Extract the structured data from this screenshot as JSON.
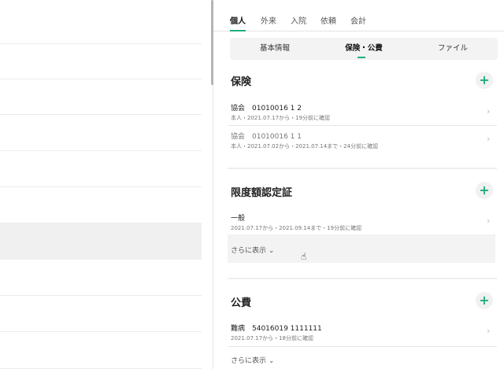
{
  "tabs": [
    "個人",
    "外来",
    "入院",
    "依頼",
    "会計"
  ],
  "subtabs": [
    "基本情報",
    "保険・公費",
    "ファイル"
  ],
  "sections": {
    "insurance": {
      "title": "保険",
      "items": [
        {
          "title": "協会　01010016 1 2",
          "sub": "本人・2021.07.17から・19分前に確認"
        },
        {
          "title": "協会　01010016 1 1",
          "sub": "本人・2021.07.02から・2021.07.14まで・24分前に確認"
        }
      ]
    },
    "limit": {
      "title": "限度額認定証",
      "items": [
        {
          "title": "一般",
          "sub": "2021.07.17から・2021.09.14まで・19分前に確認"
        }
      ],
      "more": "さらに表示 ⌄"
    },
    "public": {
      "title": "公費",
      "items": [
        {
          "title": "難病　54016019 1111111",
          "sub": "2021.07.17から・18分前に確認"
        }
      ],
      "more": "さらに表示 ⌄"
    }
  },
  "icons": {
    "plus": "+",
    "chevron": "›"
  },
  "accent": "#1fae7e"
}
